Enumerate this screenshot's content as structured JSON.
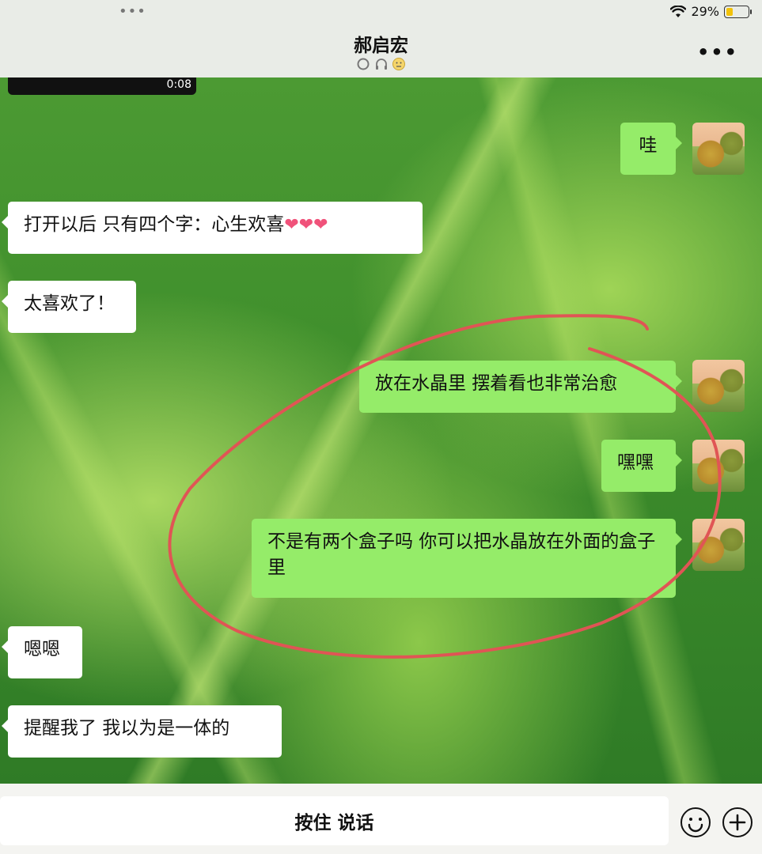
{
  "status_bar": {
    "battery": "29%",
    "battery_level": 0.29
  },
  "header": {
    "contact_name": "郝启宏",
    "status_icons": [
      "ring-icon",
      "headphones-icon",
      "neutral-face-icon"
    ]
  },
  "video": {
    "duration": "0:08"
  },
  "messages": [
    {
      "side": "right",
      "text": "哇"
    },
    {
      "side": "left",
      "text": "打开以后 只有四个字：心生欢喜",
      "emoji": "❤❤❤"
    },
    {
      "side": "left",
      "text": "太喜欢了！"
    },
    {
      "side": "right",
      "text": "放在水晶里 摆着看也非常治愈"
    },
    {
      "side": "right",
      "text": "嘿嘿"
    },
    {
      "side": "right",
      "text": "不是有两个盒子吗 你可以把水晶放在外面的盒子里"
    },
    {
      "side": "left",
      "text": "嗯嗯"
    },
    {
      "side": "left",
      "text": "提醒我了 我以为是一体的"
    }
  ],
  "input_bar": {
    "hold_to_talk": "按住 说话"
  },
  "colors": {
    "sent_bubble": "#95ec69",
    "received_bubble": "#ffffff",
    "annotation": "#e05555",
    "header_bg": "#e9ece7"
  }
}
